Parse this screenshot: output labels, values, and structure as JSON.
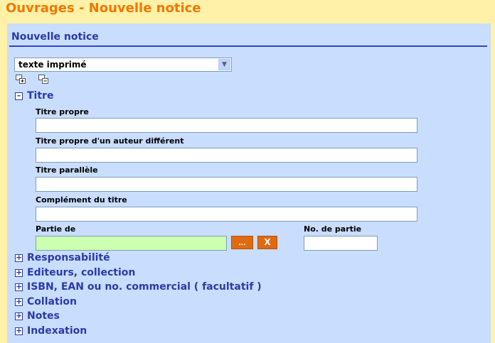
{
  "page_title": "Ouvrages - Nouvelle notice",
  "panel": {
    "title": "Nouvelle notice"
  },
  "doc_type_select": {
    "selected": "texte imprimé"
  },
  "sections": {
    "titre": {
      "label": "Titre",
      "fields": {
        "titre_propre": {
          "label": "Titre propre",
          "value": ""
        },
        "titre_auteur_different": {
          "label": "Titre propre d'un auteur différent",
          "value": ""
        },
        "titre_parallele": {
          "label": "Titre parallèle",
          "value": ""
        },
        "complement_titre": {
          "label": "Complément du titre",
          "value": ""
        },
        "partie_de": {
          "label": "Partie de",
          "value": "",
          "browse_label": "...",
          "clear_label": "X"
        },
        "no_partie": {
          "label": "No. de partie",
          "value": ""
        }
      }
    },
    "collapsed": [
      {
        "label": "Responsabilité"
      },
      {
        "label": "Editeurs, collection"
      },
      {
        "label": "ISBN, EAN ou no. commercial ( facultatif )"
      },
      {
        "label": "Collation"
      },
      {
        "label": "Notes"
      },
      {
        "label": "Indexation"
      }
    ]
  },
  "icons": {
    "expand_all": "expand-all-icon",
    "collapse_all": "collapse-all-icon",
    "expanded": "minus-box-icon",
    "collapsed": "plus-box-icon"
  },
  "colors": {
    "page_bg": "#FFF1A8",
    "title": "#F07800",
    "panel_bg": "#C9DDFF",
    "section_text": "#2A3BA8",
    "highlight_input": "#CCFFB0",
    "button": "#E06A12"
  }
}
